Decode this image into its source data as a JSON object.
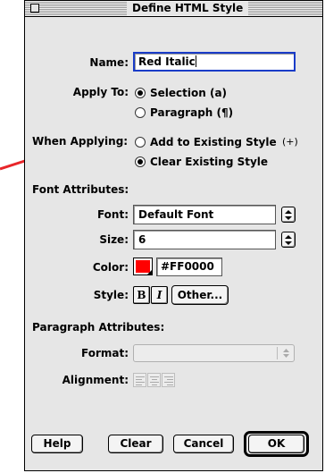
{
  "window": {
    "title": "Define HTML Style"
  },
  "name": {
    "label": "Name:",
    "value": "Red Italic"
  },
  "apply_to": {
    "label": "Apply To:",
    "options": [
      {
        "label": "Selection (a)",
        "selected": true
      },
      {
        "label": "Paragraph (¶)",
        "selected": false
      }
    ]
  },
  "when_applying": {
    "label": "When Applying:",
    "options": [
      {
        "label": "Add to Existing Style",
        "selected": false,
        "suffix": "(+)"
      },
      {
        "label": "Clear Existing Style",
        "selected": true
      }
    ]
  },
  "font_attributes": {
    "heading": "Font Attributes:",
    "font_label": "Font:",
    "font_value": "Default Font",
    "size_label": "Size:",
    "size_value": "6",
    "color_label": "Color:",
    "color_hex": "#FF0000",
    "color_swatch": "#ff0000",
    "style_label": "Style:",
    "bold_label": "B",
    "italic_label": "I",
    "other_label": "Other..."
  },
  "paragraph_attributes": {
    "heading": "Paragraph Attributes:",
    "format_label": "Format:",
    "format_value": "",
    "alignment_label": "Alignment:",
    "alignment_icons": [
      "align-left-icon",
      "align-center-icon",
      "align-right-icon"
    ]
  },
  "buttons": {
    "help": "Help",
    "clear": "Clear",
    "cancel": "Cancel",
    "ok": "OK"
  },
  "colors": {
    "window_bg": "#e6e6e6",
    "focus_ring": "#1a3cc8",
    "annotation_arrow": "#e8262a"
  }
}
